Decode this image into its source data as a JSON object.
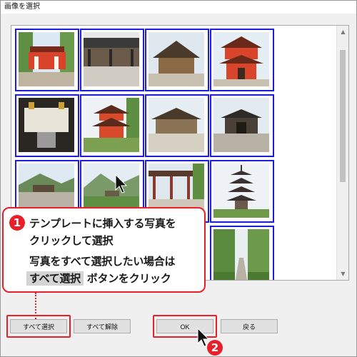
{
  "window": {
    "title": "画像を選択"
  },
  "thumbnails": [
    {
      "alt": "shrine-red-gate"
    },
    {
      "alt": "shrine-hall-interior"
    },
    {
      "alt": "temple-roof"
    },
    {
      "alt": "red-tower-gate"
    },
    {
      "alt": "shrine-altar"
    },
    {
      "alt": "red-pagoda"
    },
    {
      "alt": "temple-hall"
    },
    {
      "alt": "temple-gate"
    },
    {
      "alt": "mountain-view"
    },
    {
      "alt": "mountain-village"
    },
    {
      "alt": "corridor"
    },
    {
      "alt": "five-story-pagoda"
    },
    {
      "alt": "garden-path"
    }
  ],
  "callout": {
    "step1_number": "1",
    "line1": "テンプレートに挿入する写真を",
    "line2": "クリックして選択",
    "line3": "写真をすべて選択したい場合は",
    "line4_highlight": "すべて選択",
    "line4_rest": "ボタンをクリック"
  },
  "buttons": {
    "select_all": "すべて選択",
    "deselect_all": "すべて解除",
    "ok": "OK",
    "back": "戻る"
  },
  "step2_number": "2",
  "colors": {
    "selection_border": "#1c1cdc",
    "callout_red": "#e8202a"
  }
}
